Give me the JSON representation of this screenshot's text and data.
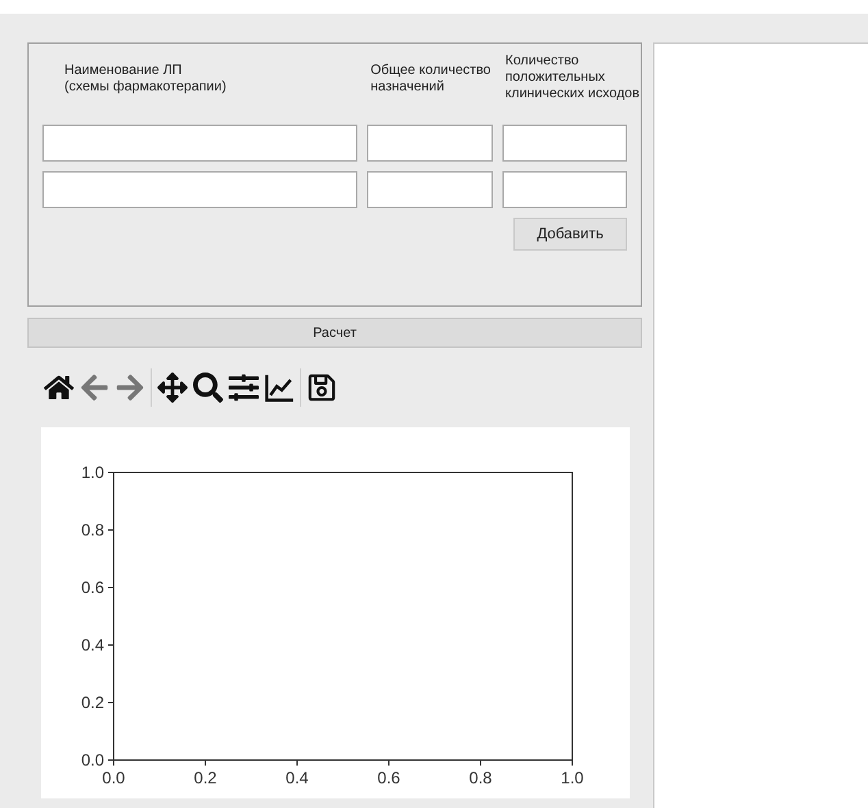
{
  "form": {
    "headers": [
      "Наименование ЛП\n(схемы фармакотерапии)",
      "Общее количество\nназначений",
      "Количество\nположительных\nклинических исходов"
    ],
    "rows": [
      {
        "fields": [
          {
            "kind": "text"
          },
          {
            "kind": "text"
          },
          {
            "kind": "text"
          }
        ]
      },
      {
        "fields": [
          {
            "kind": "text"
          },
          {
            "kind": "text"
          },
          {
            "kind": "text"
          }
        ]
      }
    ],
    "add_button": "Добавить"
  },
  "calc_button": "Расчет",
  "toolbar": [
    {
      "kind": "home",
      "disabled": false
    },
    {
      "kind": "back",
      "disabled": true
    },
    {
      "kind": "forward",
      "disabled": true
    },
    {
      "kind": "separator"
    },
    {
      "kind": "pan",
      "disabled": false
    },
    {
      "kind": "zoom",
      "disabled": false
    },
    {
      "kind": "subplots",
      "disabled": false
    },
    {
      "kind": "axes",
      "disabled": false
    },
    {
      "kind": "separator"
    },
    {
      "kind": "save",
      "disabled": false
    }
  ],
  "plot": {
    "chart_data": {
      "type": "line",
      "xlim": [
        0,
        1
      ],
      "ylim": [
        0,
        1
      ],
      "xticks": [
        {
          "value": 0,
          "label": "0.0"
        },
        {
          "value": 0.2,
          "label": "0.2"
        },
        {
          "value": 0.4,
          "label": "0.4"
        },
        {
          "value": 0.6,
          "label": "0.6"
        },
        {
          "value": 0.8,
          "label": "0.8"
        },
        {
          "value": 1,
          "label": "1.0"
        }
      ],
      "yticks": [
        {
          "value": 0,
          "label": "0.0"
        },
        {
          "value": 0.2,
          "label": "0.2"
        },
        {
          "value": 0.4,
          "label": "0.4"
        },
        {
          "value": 0.6,
          "label": "0.6"
        },
        {
          "value": 0.8,
          "label": "0.8"
        },
        {
          "value": 1,
          "label": "1.0"
        }
      ]
    }
  }
}
